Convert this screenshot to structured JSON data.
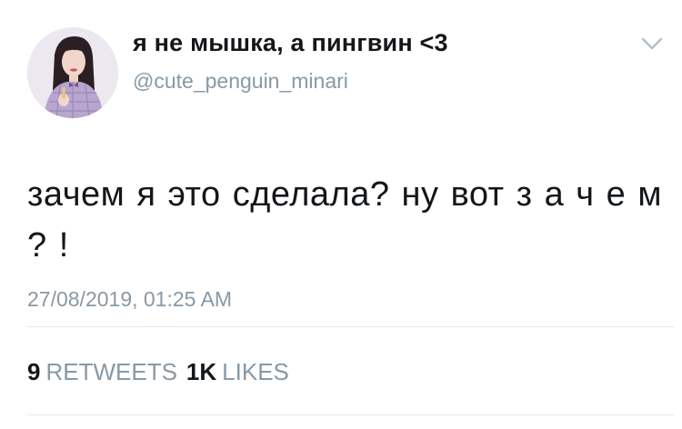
{
  "tweet": {
    "display_name": "я не мышка, а пингвин <3",
    "username": "@cute_penguin_minari",
    "text": "зачем я это сделала? ну вот з а ч е м ? !",
    "timestamp": "27/08/2019, 01:25 AM",
    "retweets_count": "9",
    "retweets_label": "RETWEETS",
    "likes_count": "1K",
    "likes_label": "LIKES",
    "avatar_icon": "profile-photo",
    "menu_icon": "chevron-down-icon"
  },
  "colors": {
    "text": "#14171a",
    "secondary": "#8899a6",
    "divider": "#e1e8ed"
  }
}
